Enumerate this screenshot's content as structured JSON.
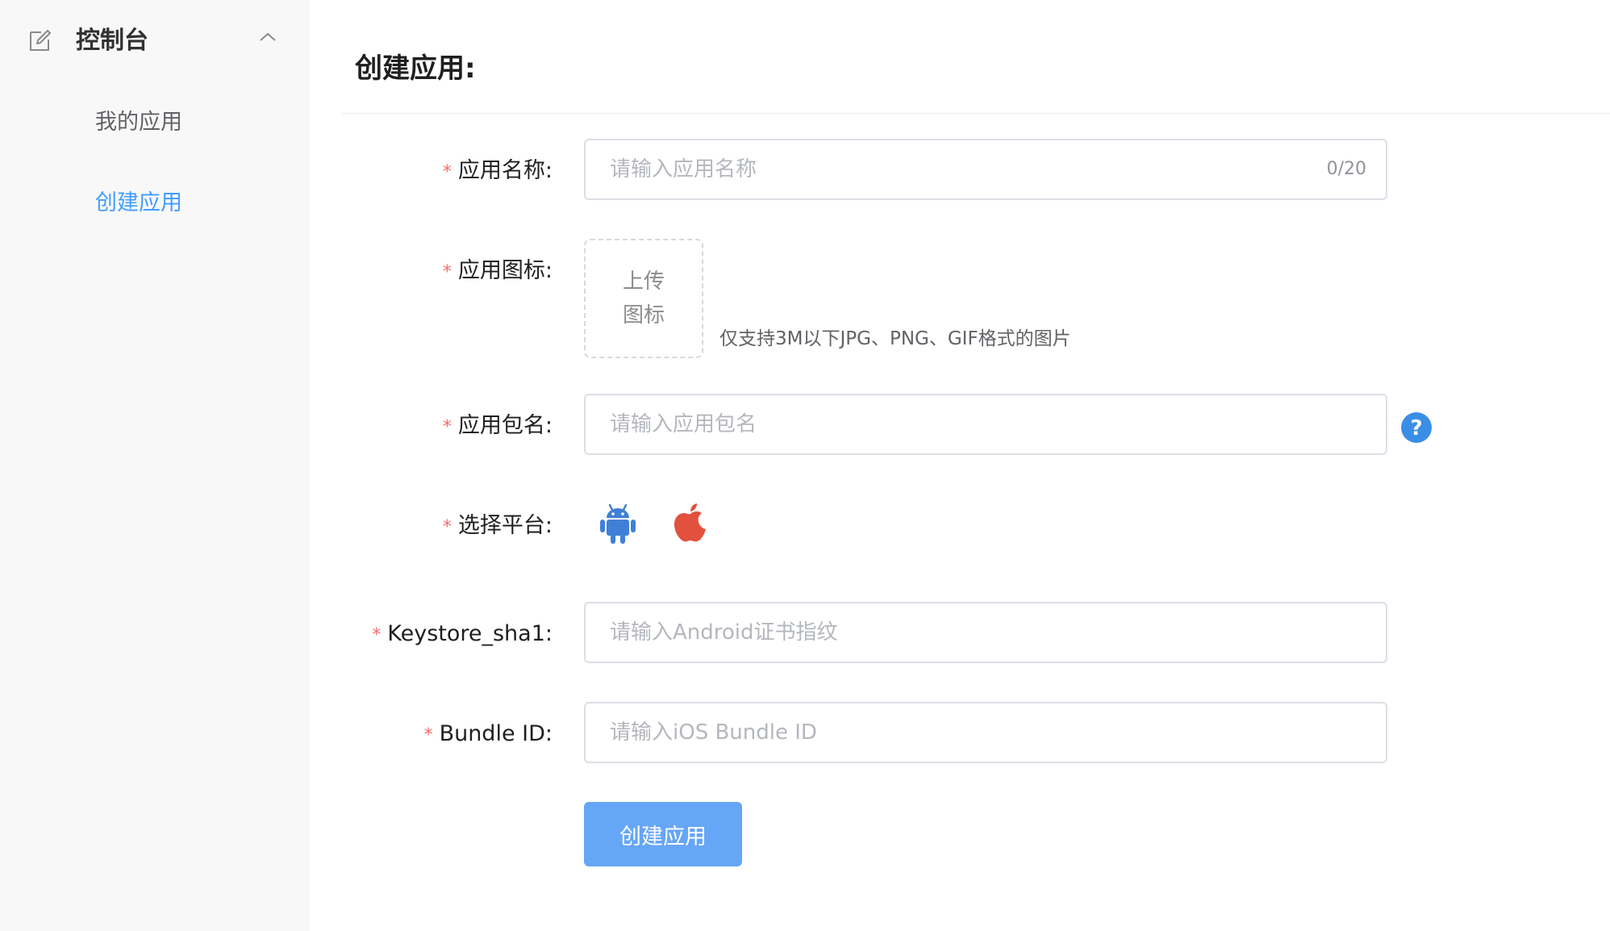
{
  "sidebar": {
    "section_title": "控制台",
    "items": [
      {
        "label": "我的应用",
        "active": false
      },
      {
        "label": "创建应用",
        "active": true
      }
    ]
  },
  "main": {
    "page_title": "创建应用:",
    "form": {
      "app_name": {
        "label": "应用名称:",
        "placeholder": "请输入应用名称",
        "value": "",
        "counter": "0/20"
      },
      "app_icon": {
        "label": "应用图标:",
        "upload_line1": "上传",
        "upload_line2": "图标",
        "hint": "仅支持3M以下JPG、PNG、GIF格式的图片"
      },
      "package_name": {
        "label": "应用包名:",
        "placeholder": "请输入应用包名",
        "value": ""
      },
      "platform": {
        "label": "选择平台:",
        "options": [
          {
            "name": "android",
            "icon": "android-icon",
            "color": "#3f80d6"
          },
          {
            "name": "ios",
            "icon": "apple-icon",
            "color": "#e2513d"
          }
        ]
      },
      "keystore_sha1": {
        "label": "Keystore_sha1:",
        "placeholder": "请输入Android证书指纹",
        "value": ""
      },
      "bundle_id": {
        "label": "Bundle ID:",
        "placeholder": "请输入iOS Bundle ID",
        "value": ""
      },
      "required_mark": "*",
      "submit_label": "创建应用"
    }
  },
  "colors": {
    "accent": "#409eff",
    "button": "#66a6f6",
    "required": "#f56c6c",
    "help": "#3a8ee6"
  }
}
